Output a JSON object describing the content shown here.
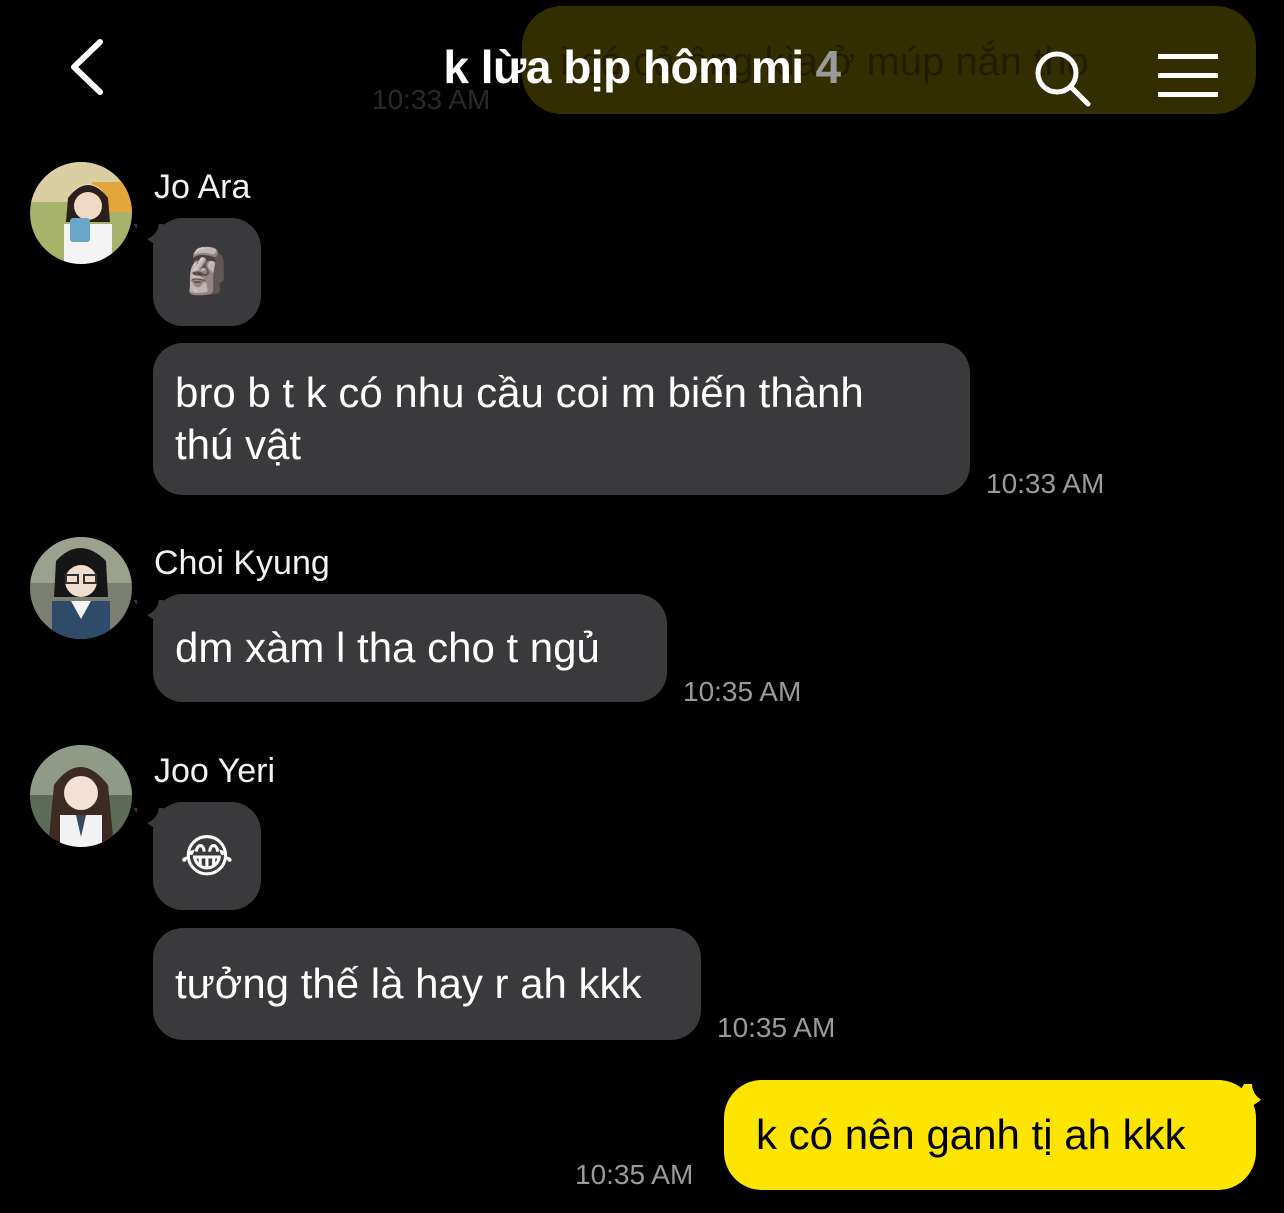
{
  "header": {
    "title": "k lừa bịp hôm mi",
    "member_count": "4",
    "back_icon": "chevron-left-icon",
    "search_icon": "search-icon",
    "menu_icon": "hamburger-menu-icon"
  },
  "background_message": {
    "text": "i có cả ông kìa ở múp nắn tho",
    "time": "10:33 AM"
  },
  "groups": [
    {
      "sender": "Jo Ara",
      "messages": [
        {
          "type": "emoji",
          "text": "🗿"
        },
        {
          "type": "text",
          "text": "bro b t k có nhu cầu coi m biến thành\nthú vật",
          "time": "10:33 AM"
        }
      ]
    },
    {
      "sender": "Choi Kyung",
      "messages": [
        {
          "type": "text",
          "text": "dm xàm l tha cho t ngủ",
          "time": "10:35 AM"
        }
      ]
    },
    {
      "sender": "Joo Yeri",
      "messages": [
        {
          "type": "emoji",
          "text": "😂"
        },
        {
          "type": "text",
          "text": "tưởng thế là hay r ah kkk",
          "time": "10:35 AM"
        }
      ]
    }
  ],
  "my_message": {
    "text": "k có nên ganh tị ah kkk",
    "time": "10:35 AM"
  },
  "colors": {
    "my_bubble": "#FEE500",
    "other_bubble": "#3A3A3C",
    "background": "#000000"
  }
}
